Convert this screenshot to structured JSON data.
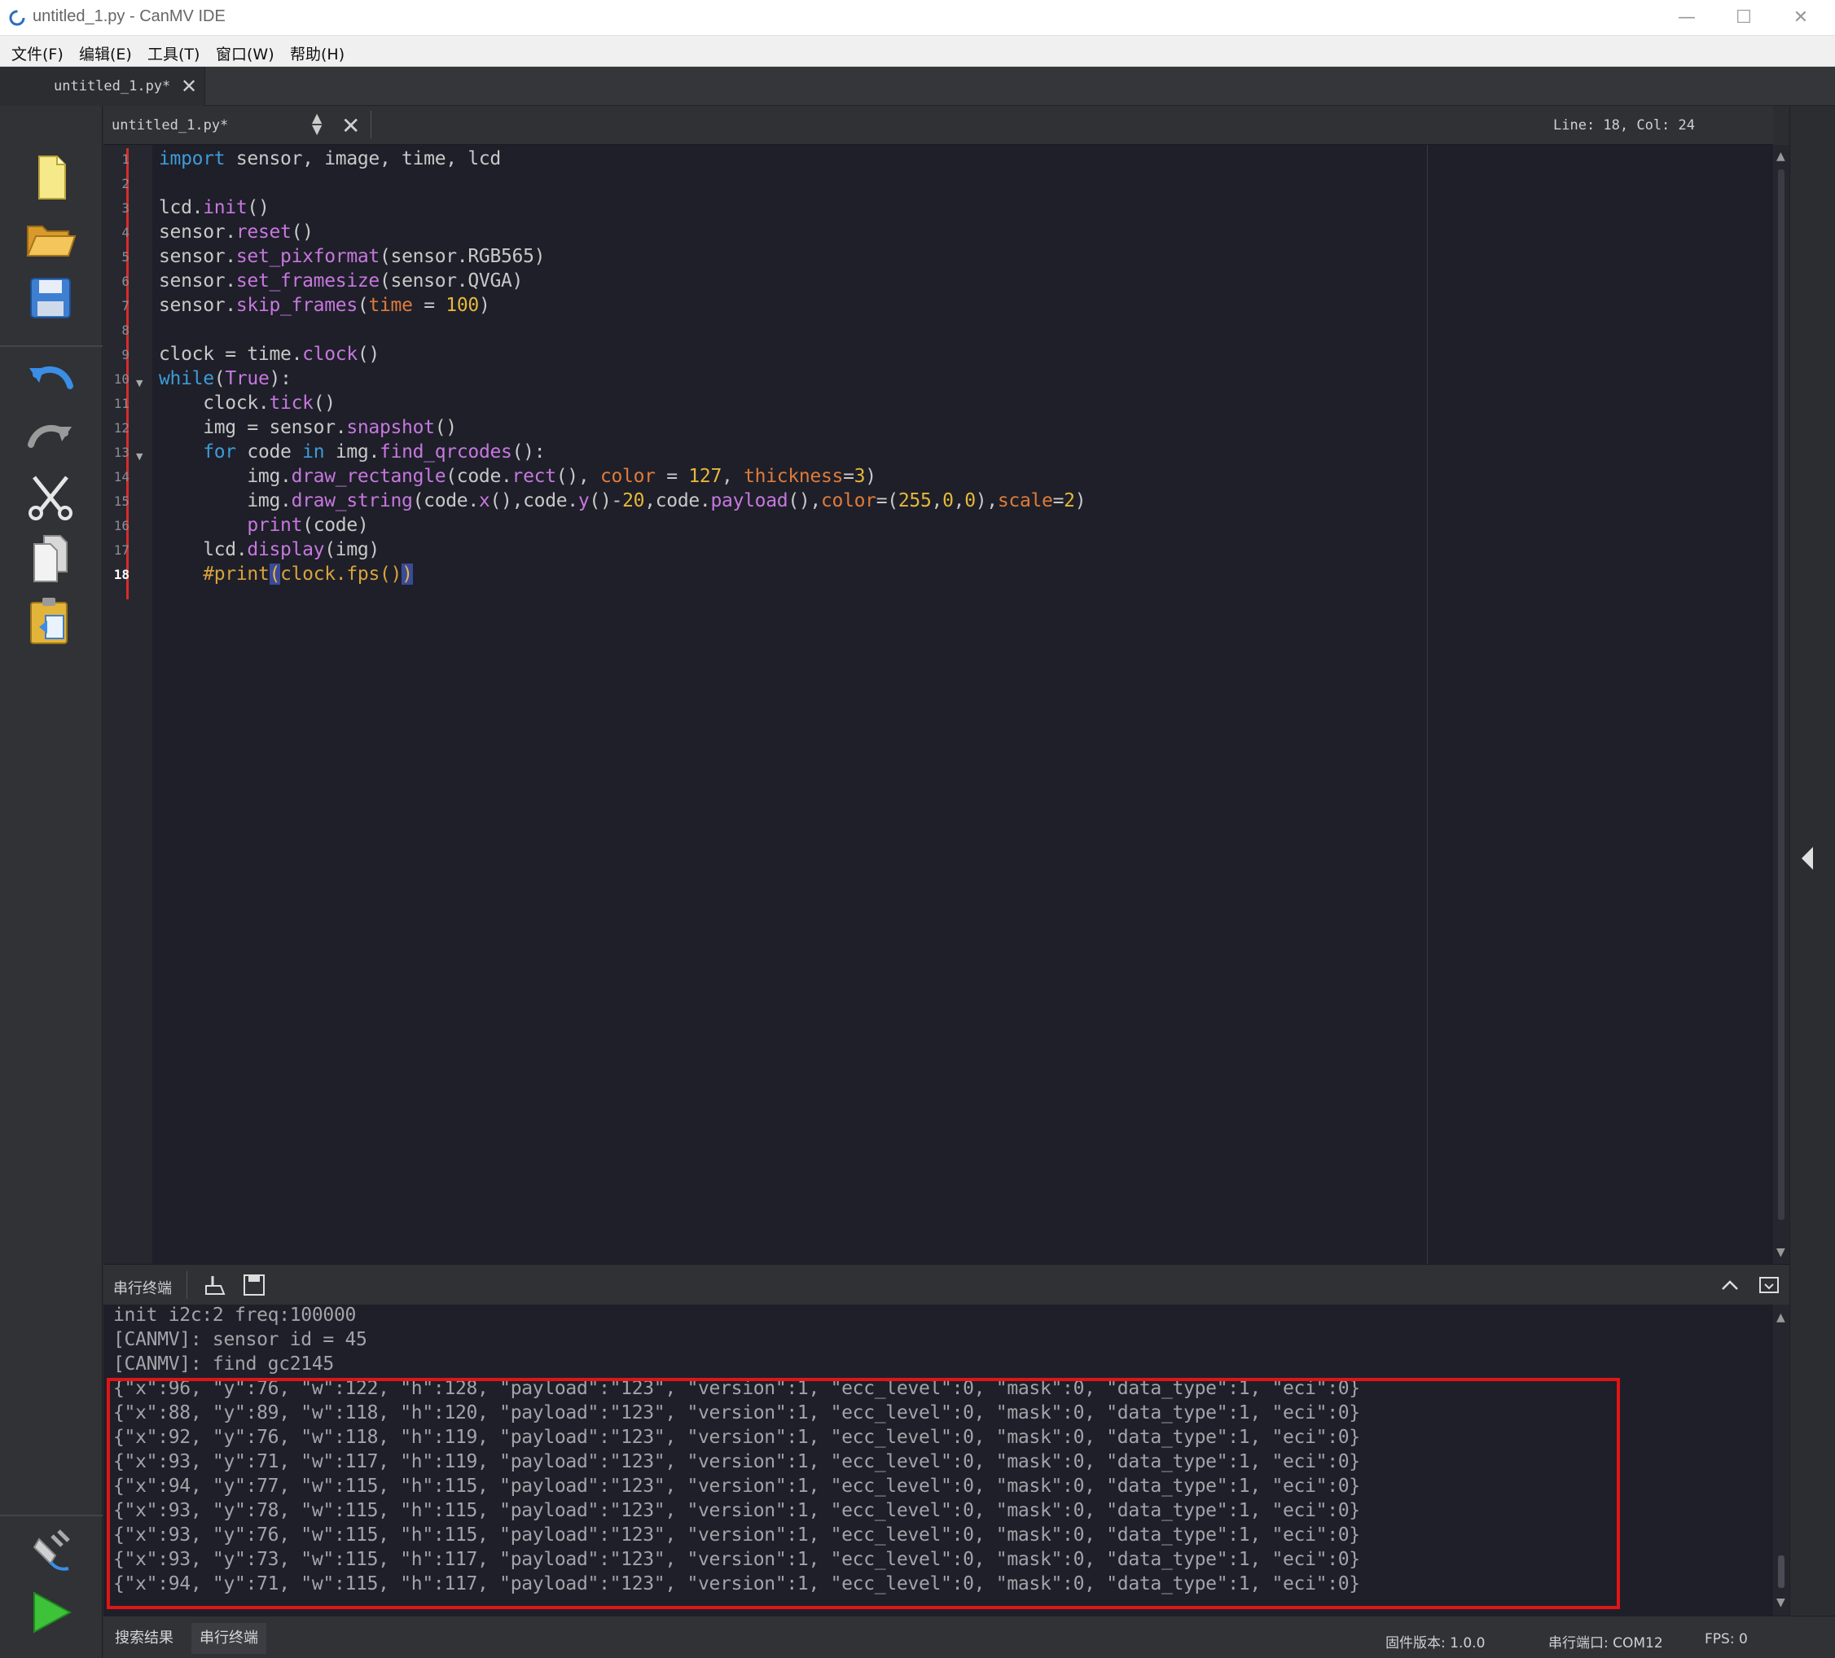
{
  "window": {
    "title": "untitled_1.py - CanMV IDE",
    "minimize": "—",
    "maximize": "☐",
    "close": "✕"
  },
  "menu": [
    "文件(F)",
    "编辑(E)",
    "工具(T)",
    "窗口(W)",
    "帮助(H)"
  ],
  "file_tab": {
    "label": "untitled_1.py*",
    "close": "✕"
  },
  "editor_header": {
    "document": "untitled_1.py*",
    "close": "✕",
    "cursor_position": "Line: 18, Col: 24"
  },
  "toolbar_icons": [
    "new-file-icon",
    "open-folder-icon",
    "save-icon",
    "undo-icon",
    "redo-icon",
    "cut-icon",
    "copy-icon",
    "paste-icon",
    "connect-icon",
    "run-icon"
  ],
  "editor": {
    "current_line": 18,
    "line_numbers": [
      "1",
      "2",
      "3",
      "4",
      "5",
      "6",
      "7",
      "8",
      "9",
      "10",
      "11",
      "12",
      "13",
      "14",
      "15",
      "16",
      "17",
      "18"
    ],
    "lines": [
      "import sensor, image, time, lcd",
      "",
      "lcd.init()",
      "sensor.reset()",
      "sensor.set_pixformat(sensor.RGB565)",
      "sensor.set_framesize(sensor.QVGA)",
      "sensor.skip_frames(time = 100)",
      "",
      "clock = time.clock()",
      "while(True):",
      "    clock.tick()",
      "    img = sensor.snapshot()",
      "    for code in img.find_qrcodes():",
      "        img.draw_rectangle(code.rect(), color = 127, thickness=3)",
      "        img.draw_string(code.x(),code.y()-20,code.payload(),color=(255,0,0),scale=2)",
      "        print(code)",
      "    lcd.display(img)",
      "    #print(clock.fps())"
    ]
  },
  "terminal": {
    "title": "串行终端",
    "lines": [
      "init i2c:2 freq:100000",
      "[CANMV]: sensor id = 45",
      "[CANMV]: find gc2145",
      "{\"x\":96, \"y\":76, \"w\":122, \"h\":128, \"payload\":\"123\", \"version\":1, \"ecc_level\":0, \"mask\":0, \"data_type\":1, \"eci\":0}",
      "{\"x\":88, \"y\":89, \"w\":118, \"h\":120, \"payload\":\"123\", \"version\":1, \"ecc_level\":0, \"mask\":0, \"data_type\":1, \"eci\":0}",
      "{\"x\":92, \"y\":76, \"w\":118, \"h\":119, \"payload\":\"123\", \"version\":1, \"ecc_level\":0, \"mask\":0, \"data_type\":1, \"eci\":0}",
      "{\"x\":93, \"y\":71, \"w\":117, \"h\":119, \"payload\":\"123\", \"version\":1, \"ecc_level\":0, \"mask\":0, \"data_type\":1, \"eci\":0}",
      "{\"x\":94, \"y\":77, \"w\":115, \"h\":115, \"payload\":\"123\", \"version\":1, \"ecc_level\":0, \"mask\":0, \"data_type\":1, \"eci\":0}",
      "{\"x\":93, \"y\":78, \"w\":115, \"h\":115, \"payload\":\"123\", \"version\":1, \"ecc_level\":0, \"mask\":0, \"data_type\":1, \"eci\":0}",
      "{\"x\":93, \"y\":76, \"w\":115, \"h\":115, \"payload\":\"123\", \"version\":1, \"ecc_level\":0, \"mask\":0, \"data_type\":1, \"eci\":0}",
      "{\"x\":93, \"y\":73, \"w\":115, \"h\":117, \"payload\":\"123\", \"version\":1, \"ecc_level\":0, \"mask\":0, \"data_type\":1, \"eci\":0}",
      "{\"x\":94, \"y\":71, \"w\":115, \"h\":117, \"payload\":\"123\", \"version\":1, \"ecc_level\":0, \"mask\":0, \"data_type\":1, \"eci\":0}"
    ]
  },
  "statusbar": {
    "tabs": [
      "搜索结果",
      "串行终端"
    ],
    "firmware": "固件版本: 1.0.0",
    "serial_port": "串行端口: COM12",
    "fps": "FPS: 0"
  },
  "colors": {
    "keyword": "#3e9bd6",
    "function": "#c678dd",
    "number": "#e5b83a",
    "parameter": "#e07b39",
    "highlight_box": "#e01515",
    "editor_bg": "#1e1f29"
  }
}
